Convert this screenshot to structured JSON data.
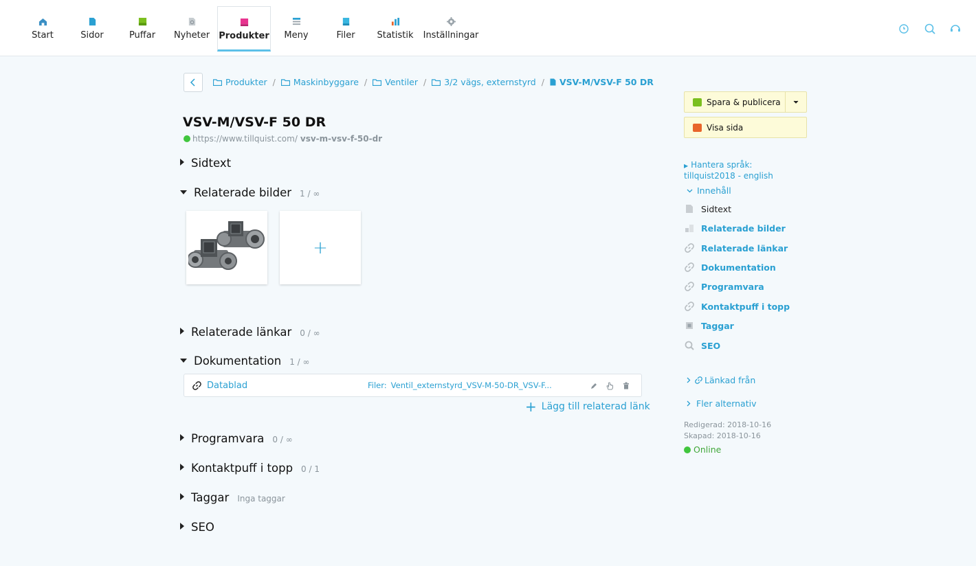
{
  "nav": {
    "items": [
      {
        "label": "Start",
        "icon": "house-icon",
        "color": "#3a8fc4"
      },
      {
        "label": "Sidor",
        "icon": "page-icon",
        "color": "#2aa0d2"
      },
      {
        "label": "Puffar",
        "icon": "puff-icon",
        "color": "#7bbf1e"
      },
      {
        "label": "Nyheter",
        "icon": "news-icon",
        "color": "#9aa4ab"
      },
      {
        "label": "Produkter",
        "icon": "product-icon",
        "color": "#e8338f"
      },
      {
        "label": "Meny",
        "icon": "menu-icon",
        "color": "#2aa0d2"
      },
      {
        "label": "Filer",
        "icon": "file-icon",
        "color": "#38b6e0"
      },
      {
        "label": "Statistik",
        "icon": "stats-icon",
        "color": "#e8652b"
      },
      {
        "label": "Inställningar",
        "icon": "gear-icon",
        "color": "#9aa4ab"
      }
    ],
    "active": "Produkter"
  },
  "breadcrumb": {
    "items": [
      "Produkter",
      "Maskinbyggare",
      "Ventiler",
      "3/2 vägs, externstyrd"
    ],
    "current": "VSV-M/VSV-F 50 DR",
    "separator": "/"
  },
  "page": {
    "title": "VSV-M/VSV-F 50 DR",
    "url_base": "https://www.tillquist.com/",
    "url_slug": "vsv-m-vsv-f-50-dr"
  },
  "sections": {
    "sidtext": {
      "name": "Sidtext"
    },
    "bilder": {
      "name": "Relaterade bilder",
      "count": "1 / ∞"
    },
    "lankar": {
      "name": "Relaterade länkar",
      "count": "0 / ∞"
    },
    "dokumentation": {
      "name": "Dokumentation",
      "count": "1 / ∞"
    },
    "programvara": {
      "name": "Programvara",
      "count": "0 / ∞"
    },
    "kontaktpuff": {
      "name": "Kontaktpuff i topp",
      "count": "0 / 1"
    },
    "taggar": {
      "name": "Taggar",
      "count": "Inga taggar"
    },
    "seo": {
      "name": "SEO"
    }
  },
  "images": {
    "add": "+"
  },
  "documentation": {
    "link": "Datablad",
    "files_label": "Filer:",
    "files_value": "Ventil_externstyrd_VSV-M-50-DR_VSV-F...",
    "add_label": "Lägg till relaterad länk",
    "add_symbol": "+"
  },
  "sidebar": {
    "publish": "Spara & publicera",
    "view": "Visa sida",
    "language": "Hantera språk: tillquist2018 - english",
    "content_group": "Innehåll",
    "items": [
      {
        "label": "Sidtext",
        "icon": "document-icon"
      },
      {
        "label": "Relaterade bilder",
        "icon": "image-icon"
      },
      {
        "label": "Relaterade länkar",
        "icon": "link-icon"
      },
      {
        "label": "Dokumentation",
        "icon": "link-icon"
      },
      {
        "label": "Programvara",
        "icon": "link-icon"
      },
      {
        "label": "Kontaktpuff i topp",
        "icon": "link-icon"
      },
      {
        "label": "Taggar",
        "icon": "tag-icon"
      },
      {
        "label": "SEO",
        "icon": "search-icon"
      }
    ],
    "linked_from": "Länkad från",
    "more": "Fler alternativ",
    "edited": "Redigerad: 2018-10-16",
    "created": "Skapad: 2018-10-16",
    "status": "Online"
  }
}
